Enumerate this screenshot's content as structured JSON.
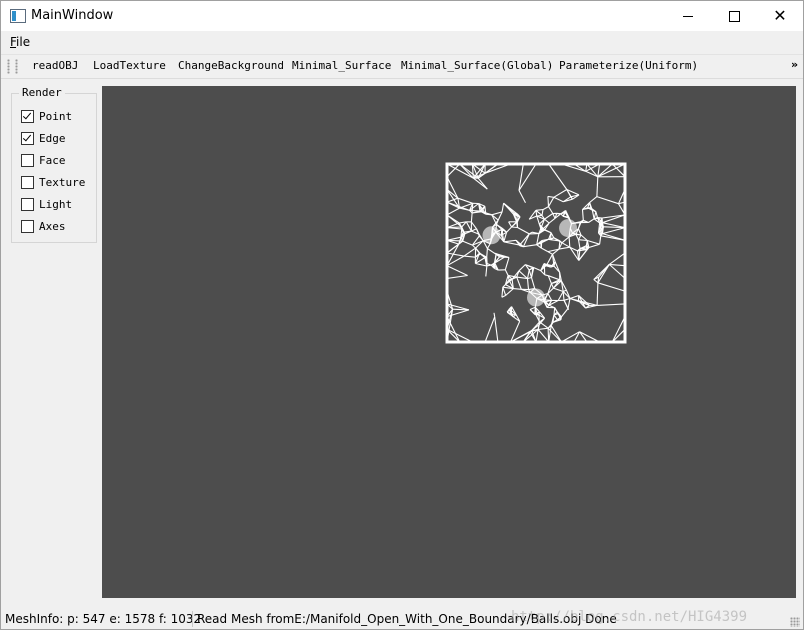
{
  "window": {
    "title": "MainWindow"
  },
  "menu": {
    "file_accel": "F",
    "file_rest": "ile"
  },
  "toolbar": {
    "buttons": [
      "readOBJ",
      "LoadTexture",
      "ChangeBackground",
      "Minimal_Surface",
      "Minimal_Surface(Global)",
      "Parameterize(Uniform)"
    ],
    "overflow": "»"
  },
  "render_panel": {
    "title": "Render",
    "options": [
      {
        "label": "Point",
        "checked": true
      },
      {
        "label": "Edge",
        "checked": true
      },
      {
        "label": "Face",
        "checked": false
      },
      {
        "label": "Texture",
        "checked": false
      },
      {
        "label": "Light",
        "checked": false
      },
      {
        "label": "Axes",
        "checked": false
      }
    ]
  },
  "viewport": {
    "background": "#4d4d4d",
    "mesh_color": "#ffffff"
  },
  "status": {
    "mesh_info": "MeshInfo: p: 547 e: 1578 f: 1032",
    "message": "Read Mesh fromE:/Manifold_Open_With_One_Boundary/Balls.obj Done",
    "watermark": "http://blog.csdn.net/HIG4399"
  }
}
